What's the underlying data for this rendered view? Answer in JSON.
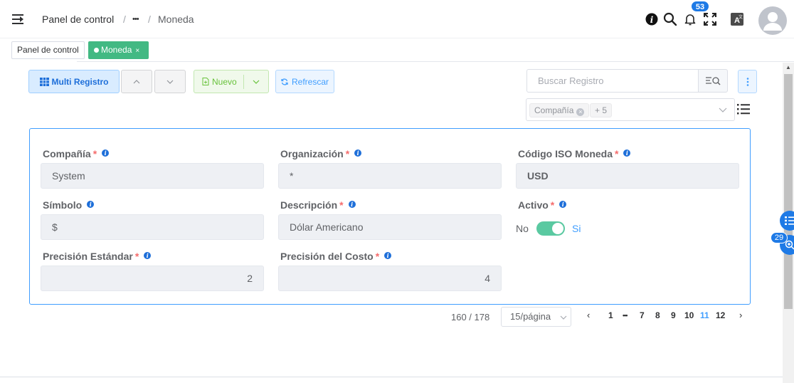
{
  "header": {
    "breadcrumb": [
      "Panel de control",
      "/",
      "•••",
      "/",
      "Moneda"
    ],
    "notifications_count": "53",
    "icons": [
      "menu-fold-icon",
      "info-icon",
      "search-icon",
      "bell-icon",
      "fullscreen-icon",
      "translate-icon",
      "user-avatar-icon"
    ]
  },
  "tags": {
    "home": "Panel de control",
    "active": "Moneda",
    "close": "×"
  },
  "toolbar": {
    "multi_label": "Multi Registro",
    "new_label": "Nuevo",
    "refresh_label": "Refrescar",
    "search_placeholder": "Buscar Registro",
    "filter_chip": "Compañía",
    "filter_more": "+ 5"
  },
  "form": {
    "company": {
      "label": "Compañía",
      "required": "*",
      "value": "System"
    },
    "organization": {
      "label": "Organización",
      "required": "*",
      "value": "*"
    },
    "iso_code": {
      "label": "Código ISO Moneda",
      "required": "*",
      "value": "USD"
    },
    "symbol": {
      "label": "Símbolo",
      "value": "$"
    },
    "description": {
      "label": "Descripción",
      "required": "*",
      "value": "Dólar Americano"
    },
    "active": {
      "label": "Activo",
      "required": "*",
      "off_label": "No",
      "on_label": "Si",
      "value": true
    },
    "std_precision": {
      "label": "Precisión Estándar",
      "required": "*",
      "value": "2"
    },
    "cost_precision": {
      "label": "Precisión del Costo",
      "required": "*",
      "value": "4"
    }
  },
  "pagination": {
    "total": "160 / 178",
    "page_size": "15/página",
    "pages": [
      "1",
      "•••",
      "7",
      "8",
      "9",
      "10",
      "11",
      "12"
    ],
    "current": "11"
  },
  "floating": {
    "badge": "29"
  },
  "colors": {
    "accent": "#409eff",
    "success": "#42b983",
    "toggle_on": "#5ac9a1",
    "required": "#f56c6c"
  }
}
